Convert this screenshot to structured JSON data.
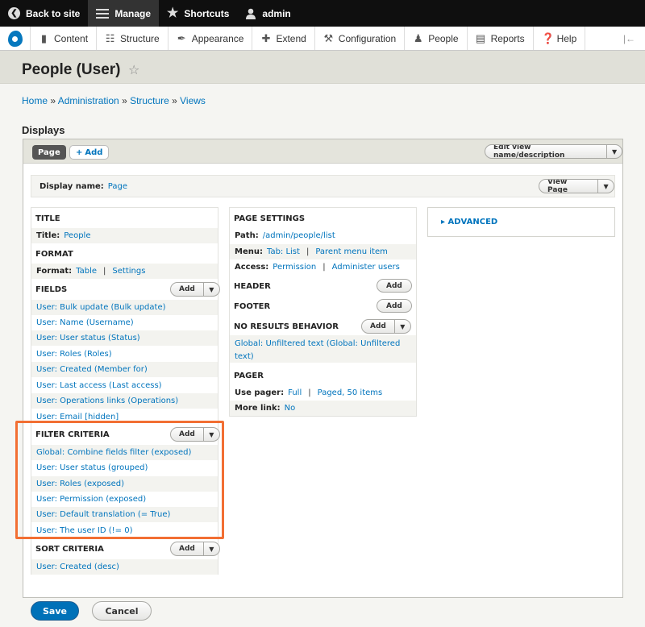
{
  "toolbar": {
    "back": "Back to site",
    "manage": "Manage",
    "shortcuts": "Shortcuts",
    "user": "admin"
  },
  "tray": {
    "items": [
      {
        "label": "Content",
        "icon": "file-icon"
      },
      {
        "label": "Structure",
        "icon": "sitemap-icon"
      },
      {
        "label": "Appearance",
        "icon": "brush-icon"
      },
      {
        "label": "Extend",
        "icon": "puzzle-icon"
      },
      {
        "label": "Configuration",
        "icon": "wrench-icon"
      },
      {
        "label": "People",
        "icon": "people-icon"
      },
      {
        "label": "Reports",
        "icon": "bar-chart-icon"
      },
      {
        "label": "Help",
        "icon": "help-icon"
      }
    ]
  },
  "page": {
    "title": "People (User)"
  },
  "breadcrumb": [
    {
      "label": "Home"
    },
    {
      "label": "Administration"
    },
    {
      "label": "Structure"
    },
    {
      "label": "Views"
    }
  ],
  "displays": {
    "heading": "Displays",
    "tab_page": "Page",
    "tab_add": "Add",
    "edit_view": "Edit view name/description",
    "display_name_label": "Display name:",
    "display_name_value": "Page",
    "view_page": "View Page"
  },
  "left": {
    "title": {
      "heading": "TITLE",
      "label": "Title:",
      "value": "People"
    },
    "format": {
      "heading": "FORMAT",
      "label": "Format:",
      "value": "Table",
      "settings": "Settings"
    },
    "fields": {
      "heading": "FIELDS",
      "add": "Add",
      "items": [
        "User: Bulk update (Bulk update)",
        "User: Name (Username)",
        "User: User status (Status)",
        "User: Roles (Roles)",
        "User: Created (Member for)",
        "User: Last access (Last access)",
        "User: Operations links (Operations)",
        "User: Email [hidden]"
      ]
    },
    "filters": {
      "heading": "FILTER CRITERIA",
      "add": "Add",
      "items": [
        "Global: Combine fields filter (exposed)",
        "User: User status (grouped)",
        "User: Roles (exposed)",
        "User: Permission (exposed)",
        "User: Default translation (= True)",
        "User: The user ID (!= 0)"
      ]
    },
    "sort": {
      "heading": "SORT CRITERIA",
      "add": "Add",
      "items": [
        "User: Created (desc)"
      ]
    }
  },
  "middle": {
    "page_settings": {
      "heading": "PAGE SETTINGS",
      "path_label": "Path:",
      "path_value": "/admin/people/list",
      "menu_label": "Menu:",
      "menu_value": "Tab: List",
      "menu_parent": "Parent menu item",
      "access_label": "Access:",
      "access_value": "Permission",
      "access_perm": "Administer users"
    },
    "header": {
      "heading": "HEADER",
      "add": "Add"
    },
    "footer": {
      "heading": "FOOTER",
      "add": "Add"
    },
    "no_results": {
      "heading": "NO RESULTS BEHAVIOR",
      "add": "Add",
      "item": "Global: Unfiltered text (Global: Unfiltered text)"
    },
    "pager": {
      "heading": "PAGER",
      "use_label": "Use pager:",
      "use_value": "Full",
      "use_paged": "Paged, 50 items",
      "more_label": "More link:",
      "more_value": "No"
    }
  },
  "right": {
    "advanced": "ADVANCED"
  },
  "actions": {
    "save": "Save",
    "cancel": "Cancel"
  },
  "colors": {
    "link": "#0074bd",
    "highlight": "#f26f33",
    "save": "#0071b8"
  }
}
